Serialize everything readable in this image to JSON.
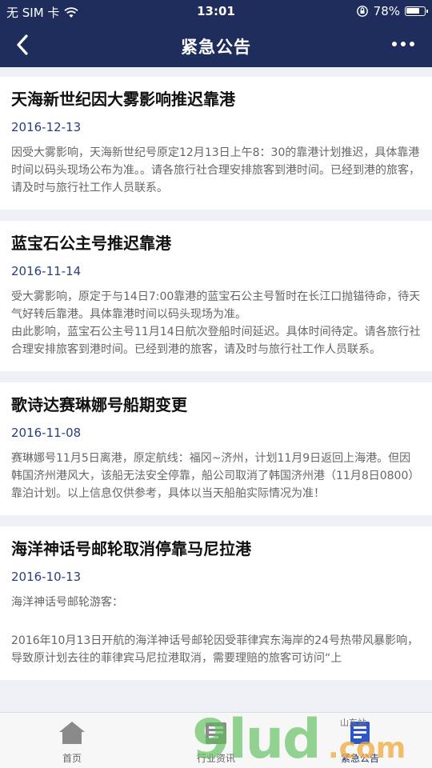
{
  "status": {
    "carrier": "无 SIM 卡",
    "time": "13:01",
    "battery": "78%",
    "battery_level": 0.78
  },
  "nav": {
    "title": "紧急公告"
  },
  "notices": [
    {
      "title": "天海新世纪因大雾影响推迟靠港",
      "date": "2016-12-13",
      "paragraphs": [
        "因受大雾影响，天海新世纪号原定12月13日上午8：30的靠港计划推迟，具体靠港时间以码头现场公布为准。。请各旅行社合理安排旅客到港时间。已经到港的旅客，请及时与旅行社工作人员联系。"
      ]
    },
    {
      "title": "蓝宝石公主号推迟靠港",
      "date": "2016-11-14",
      "paragraphs": [
        "受大雾影响，原定于与14日7:00靠港的蓝宝石公主号暂时在长江口抛锚待命，待天气好转后靠港。具体靠港时间以码头现场为准。",
        "由此影响，蓝宝石公主号11月14日航次登船时间延迟。具体时间待定。请各旅行社合理安排旅客到港时间。已经到港的旅客，请及时与旅行社工作人员联系。"
      ]
    },
    {
      "title": "歌诗达赛琳娜号船期变更",
      "date": "2016-11-08",
      "paragraphs": [
        "赛琳娜号11月5日离港，原定航线：福冈~济州，计划11月9日返回上海港。但因韩国济州港风大，该船无法安全停靠，船公司取消了韩国济州港（11月8日0800）靠泊计划。以上信息仅供参考，具体以当天船舶实际情况为准！"
      ]
    },
    {
      "title": "海洋神话号邮轮取消停靠马尼拉港",
      "date": "2016-10-13",
      "paragraphs": [
        "海洋神话号邮轮游客：",
        "2016年10月13日开航的海洋神话号邮轮因受菲律宾东海岸的24号热带风暴影响，导致原计划去往的菲律宾马尼拉港取消，需要理赔的旅客可访问“上"
      ]
    }
  ],
  "tabs": [
    {
      "label": "首页",
      "icon": "home-icon"
    },
    {
      "label": "行业资讯",
      "icon": "news-icon"
    },
    {
      "label": "紧急公告",
      "icon": "notice-icon"
    }
  ],
  "watermark": {
    "text": "9lud",
    "suffix": ".com",
    "tag": "山东站"
  }
}
